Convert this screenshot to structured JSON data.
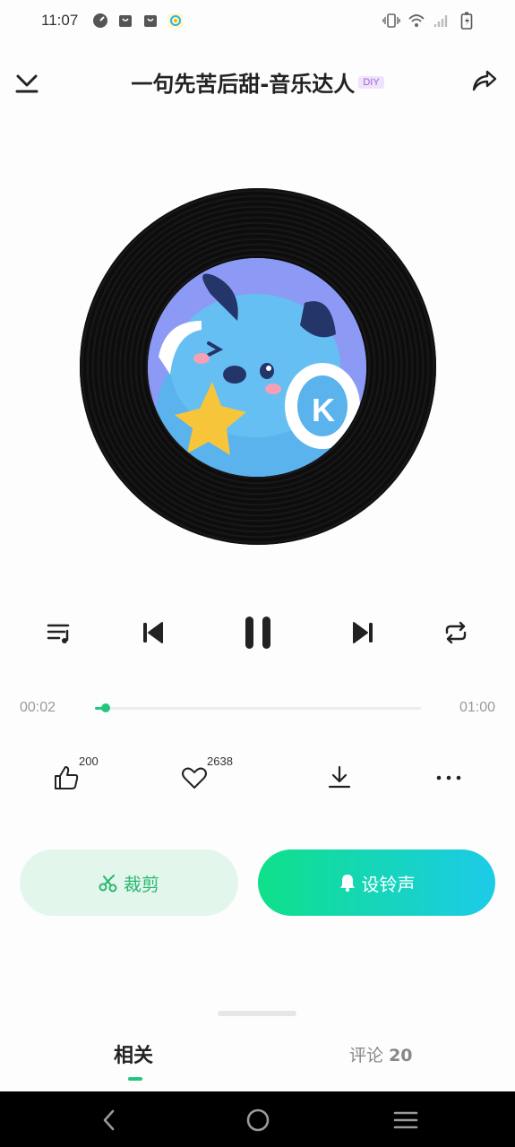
{
  "status_bar": {
    "time": "11:07",
    "left_icons": [
      "speedometer-icon",
      "bag-icon",
      "bag-icon",
      "app-icon"
    ],
    "right_icons": [
      "vibrate-icon",
      "wifi-icon",
      "signal-icon",
      "battery-icon"
    ]
  },
  "header": {
    "title": "一句先苦后甜-音乐达人",
    "badge": "DIY"
  },
  "player": {
    "current_time": "00:02",
    "total_time": "01:00",
    "progress_fraction": 0.033
  },
  "actions": {
    "like_count": "200",
    "favorite_count": "2638"
  },
  "buttons": {
    "cut_label": "裁剪",
    "ringtone_label": "设铃声"
  },
  "tabs": {
    "related_label": "相关",
    "comments_label": "评论",
    "comments_count": "20"
  },
  "colors": {
    "accent": "#22c77e",
    "gradient_start": "#0fe08a",
    "gradient_end": "#1ccbe8",
    "cover_bg": "#8c9af5"
  }
}
